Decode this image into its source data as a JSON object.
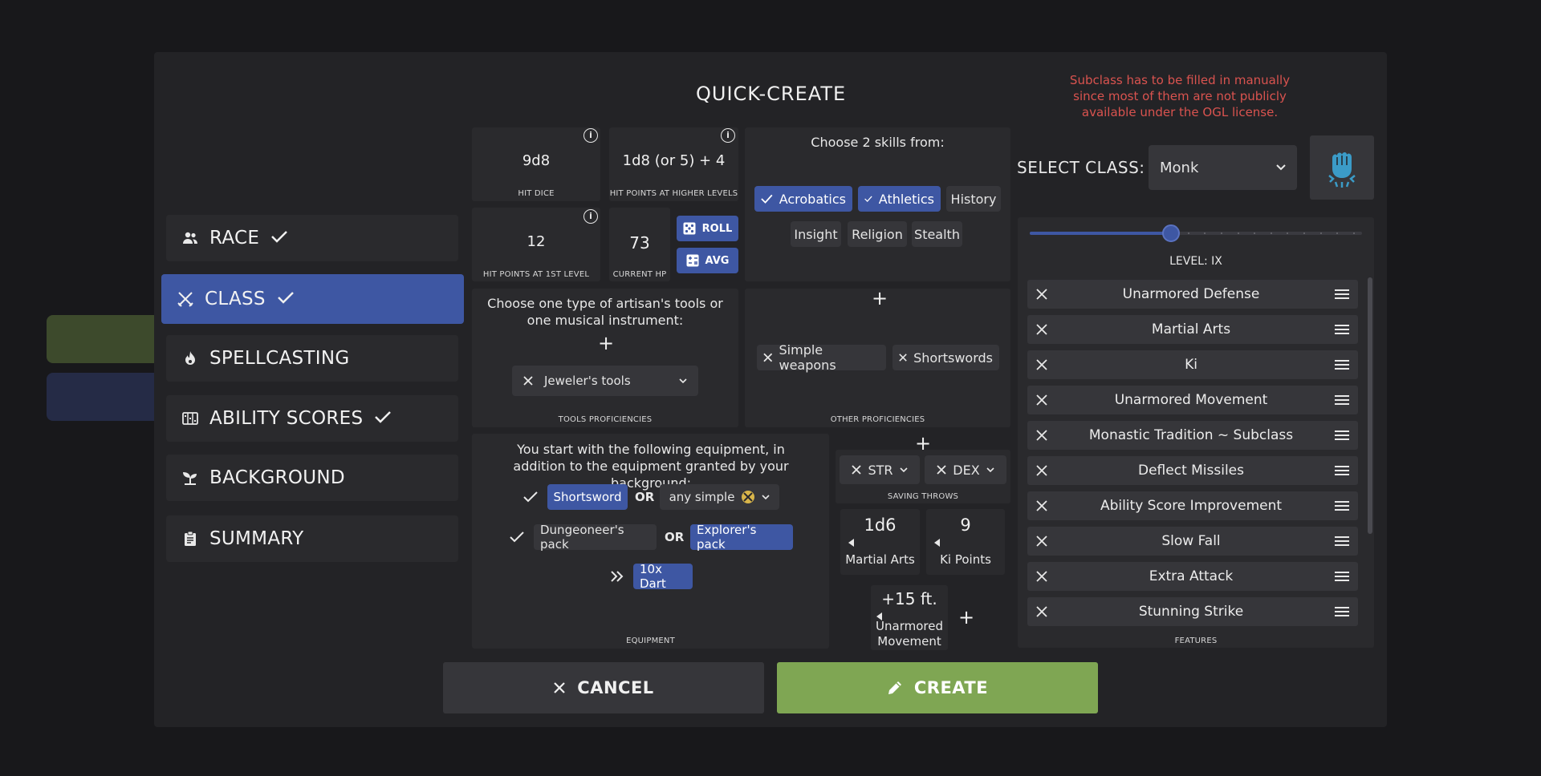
{
  "modal": {
    "title": "QUICK-CREATE",
    "warning": "Subclass has to be filled in manually since most of them are not publicly available under the OGL license."
  },
  "nav": {
    "items": [
      {
        "label": "RACE",
        "icon": "users-icon",
        "checked": true
      },
      {
        "label": "CLASS",
        "icon": "swords-icon",
        "checked": true,
        "active": true
      },
      {
        "label": "SPELLCASTING",
        "icon": "flame-icon",
        "checked": false
      },
      {
        "label": "ABILITY SCORES",
        "icon": "scores-icon",
        "checked": true
      },
      {
        "label": "BACKGROUND",
        "icon": "sprout-icon",
        "checked": false
      },
      {
        "label": "SUMMARY",
        "icon": "clipboard-icon",
        "checked": false
      }
    ]
  },
  "stats": {
    "hit_dice": {
      "value": "9d8",
      "caption": "HIT DICE"
    },
    "hp_higher": {
      "value": "1d8 (or 5) + 4",
      "caption": "HIT POINTS AT HIGHER LEVELS"
    },
    "hp_first": {
      "value": "12",
      "caption": "HIT POINTS AT 1ST LEVEL"
    },
    "current_hp": {
      "value": "73",
      "caption": "CURRENT HP"
    },
    "roll_label": "ROLL",
    "avg_label": "AVG"
  },
  "skills": {
    "prompt": "Choose 2 skills from:",
    "options": [
      {
        "label": "Acrobatics",
        "selected": true
      },
      {
        "label": "Athletics",
        "selected": true
      },
      {
        "label": "History",
        "selected": false
      },
      {
        "label": "Insight",
        "selected": false
      },
      {
        "label": "Religion",
        "selected": false
      },
      {
        "label": "Stealth",
        "selected": false
      }
    ]
  },
  "tools": {
    "prompt": "Choose one type of artisan's tools or one musical instrument:",
    "selected": "Jeweler's tools",
    "caption": "TOOLS PROFICIENCIES"
  },
  "other_prof": {
    "items": [
      "Simple weapons",
      "Shortswords"
    ],
    "caption": "OTHER PROFICIENCIES"
  },
  "equipment": {
    "intro": "You start with the following equipment, in addition to the equipment granted by your background:",
    "row1": {
      "a": "Shortsword",
      "or": "OR",
      "b": "any simple"
    },
    "row2": {
      "a": "Dungeoneer's pack",
      "or": "OR",
      "b": "Explorer's pack"
    },
    "row3": {
      "item": "10x Dart"
    },
    "caption": "EQUIPMENT"
  },
  "saving_throws": {
    "items": [
      "STR",
      "DEX"
    ],
    "caption": "SAVING THROWS"
  },
  "class_stats": [
    {
      "value": "1d6",
      "label": "Martial Arts"
    },
    {
      "value": "9",
      "label": "Ki Points"
    },
    {
      "value": "+15 ft.",
      "label": "Unarmored Movement"
    }
  ],
  "class_select": {
    "label": "SELECT CLASS:",
    "value": "Monk",
    "level_label": "LEVEL: IX",
    "level": 9,
    "max_level": 20
  },
  "features": {
    "items": [
      "Unarmored Defense",
      "Martial Arts",
      "Ki",
      "Unarmored Movement",
      "Monastic Tradition ~ Subclass",
      "Deflect Missiles",
      "Ability Score Improvement",
      "Slow Fall",
      "Extra Attack",
      "Stunning Strike"
    ],
    "caption": "FEATURES"
  },
  "footer": {
    "cancel": "CANCEL",
    "create": "CREATE"
  },
  "colors": {
    "accent": "#3e57a3",
    "create": "#7fa653",
    "warning": "#d9534f"
  }
}
